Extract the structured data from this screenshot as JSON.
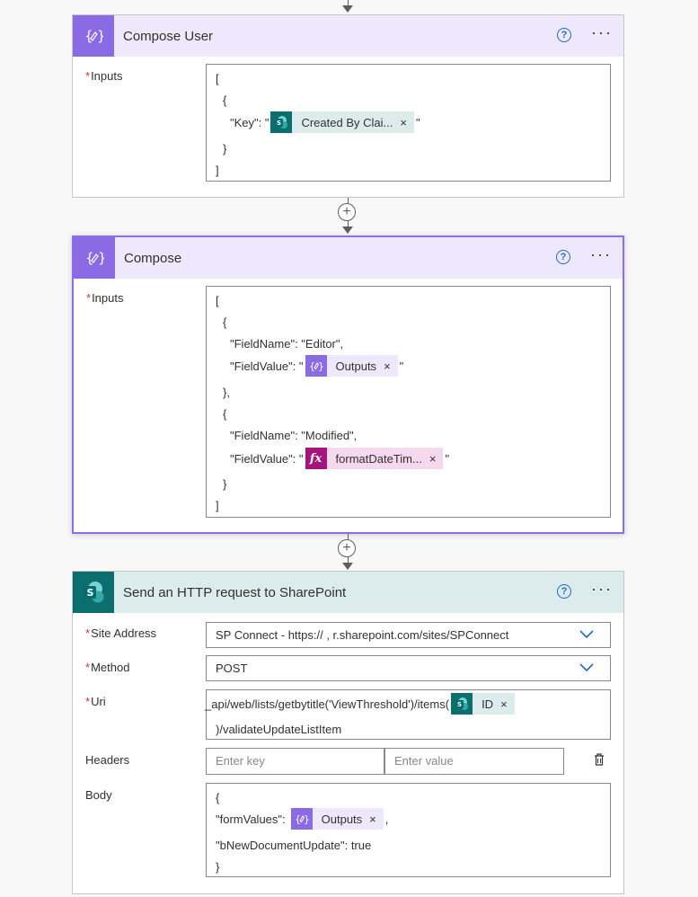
{
  "compose_user": {
    "title": "Compose User",
    "help_glyph": "?",
    "more_glyph": "···",
    "inputs_label": "Inputs",
    "required_mark": "*",
    "line1": "[",
    "line2": "{",
    "line3_pre": "\"Key\": \"",
    "line3_token": "Created By Clai...",
    "line3_post": "\"",
    "line4": "}",
    "line5": "]"
  },
  "add_step_glyph": "+",
  "compose": {
    "title": "Compose",
    "help_glyph": "?",
    "more_glyph": "···",
    "inputs_label": "Inputs",
    "required_mark": "*",
    "lines": {
      "l1": "[",
      "l2": "{",
      "l3": "\"FieldName\": \"Editor\",",
      "l4_pre": "\"FieldValue\": \"",
      "l4_token": "Outputs",
      "l4_post": "\"",
      "l5": "},",
      "l6": "{",
      "l7": "\"FieldName\": \"Modified\",",
      "l8_pre": "\"FieldValue\": \"",
      "l8_token": "formatDateTim...",
      "l8_post": "\"",
      "l9": "}",
      "l10": "]"
    }
  },
  "http": {
    "title": "Send an HTTP request to SharePoint",
    "help_glyph": "?",
    "more_glyph": "···",
    "required_mark": "*",
    "site_address_label": "Site Address",
    "site_address_value": "SP Connect - https://    ,        r.sharepoint.com/sites/SPConnect",
    "method_label": "Method",
    "method_value": "POST",
    "uri_label": "Uri",
    "uri_pre": "_api/web/lists/getbytitle('ViewThreshold')/items(",
    "uri_token": "ID",
    "uri_post": ")/validateUpdateListItem",
    "headers_label": "Headers",
    "headers_key_placeholder": "Enter key",
    "headers_value_placeholder": "Enter value",
    "body_label": "Body",
    "body_l1": "{",
    "body_l2_pre": "\"formValues\":",
    "body_l2_token": "Outputs",
    "body_l2_post": ",",
    "body_l3": "\"bNewDocumentUpdate\": true",
    "body_l4": "}"
  },
  "token_close_glyph": "×",
  "colors": {
    "compose_accent": "#8b6ae6",
    "sharepoint_accent": "#0c6f6f",
    "expression_accent": "#a4157f",
    "selected_border": "#8a6fe8",
    "link_blue": "#2367d1"
  }
}
